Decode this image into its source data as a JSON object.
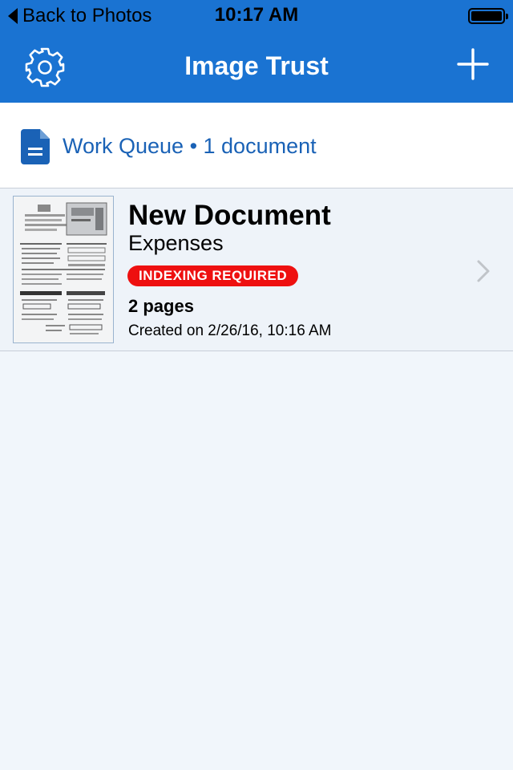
{
  "status_bar": {
    "back_label": "Back to Photos",
    "time": "10:17 AM"
  },
  "nav": {
    "title": "Image Trust",
    "settings_icon": "gear-icon",
    "add_icon": "plus-icon"
  },
  "queue": {
    "label": "Work Queue • 1 document",
    "icon": "document-icon"
  },
  "documents": [
    {
      "title": "New Document",
      "type": "Expenses",
      "badge": "INDEXING REQUIRED",
      "pages": "2 pages",
      "created": "Created on 2/26/16, 10:16 AM"
    }
  ],
  "colors": {
    "nav_blue": "#1a73d2",
    "link_blue": "#1a62b6",
    "badge_red": "#ee1010",
    "background": "#f1f6fb"
  }
}
